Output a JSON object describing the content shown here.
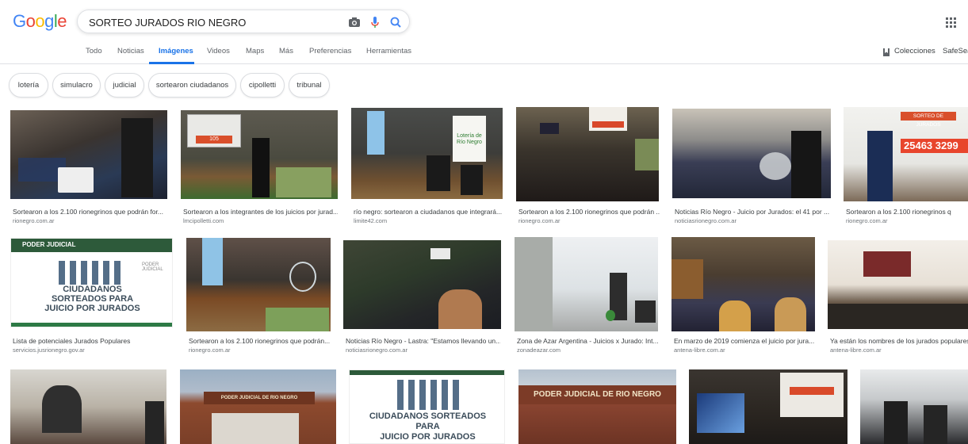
{
  "logo": {
    "letters": [
      "G",
      "o",
      "o",
      "g",
      "l",
      "e"
    ],
    "colors": [
      "#4285F4",
      "#EA4335",
      "#FBBC05",
      "#4285F4",
      "#34A853",
      "#EA4335"
    ]
  },
  "search": {
    "query": "SORTEO JURADOS RIO NEGRO",
    "camera_icon": "camera-icon",
    "mic_icon": "mic-icon",
    "search_icon": "search-icon"
  },
  "tabs": [
    {
      "label": "Todo",
      "active": false
    },
    {
      "label": "Noticias",
      "active": false
    },
    {
      "label": "Imágenes",
      "active": true
    },
    {
      "label": "Videos",
      "active": false
    },
    {
      "label": "Maps",
      "active": false
    },
    {
      "label": "Más",
      "active": false
    },
    {
      "label": "Preferencias",
      "active": false
    },
    {
      "label": "Herramientas",
      "active": false
    }
  ],
  "right_tools": {
    "collections": "Colecciones",
    "safesearch": "SafeSea"
  },
  "chips": [
    "lotería",
    "simulacro",
    "judicial",
    "sortearon ciudadanos",
    "cipolletti",
    "tribunal"
  ],
  "results": [
    {
      "title": "Sortearon a los 2.100 rionegrinos que podrán for...",
      "source": "rionegro.com.ar"
    },
    {
      "title": "Sortearon a los integrantes de los juicios por jurad...",
      "source": "lmcipolletti.com"
    },
    {
      "title": "río negro: sortearon a ciudadanos que integrará...",
      "source": "limite42.com"
    },
    {
      "title": "Sortearon a los 2.100 rionegrinos que podrán ...",
      "source": "rionegro.com.ar"
    },
    {
      "title": "Noticias Río Negro - Juicio por Jurados: el 41 por ...",
      "source": "noticiasrionegro.com.ar"
    },
    {
      "title": "Sortearon a los 2.100 rionegrinos q",
      "source": "rionegro.com.ar"
    },
    {
      "title": "Lista de potenciales Jurados Populares",
      "source": "servicios.jusrionegro.gov.ar"
    },
    {
      "title": "Sortearon a los 2.100 rionegrinos que podrán...",
      "source": "rionegro.com.ar"
    },
    {
      "title": "Noticias Río Negro - Lastra: \"Estamos llevando un...",
      "source": "noticiasrionegro.com.ar"
    },
    {
      "title": "Zona de Azar Argentina - Juicios x Jurado: Int...",
      "source": "zonadeazar.com"
    },
    {
      "title": "En marzo de 2019 comienza el juicio por jura...",
      "source": "antena-libre.com.ar"
    },
    {
      "title": "Ya están los nombres de los jurados populares",
      "source": "antena-libre.com.ar"
    },
    {
      "title": "",
      "source": ""
    },
    {
      "title": "",
      "source": ""
    },
    {
      "title": "",
      "source": ""
    },
    {
      "title": "",
      "source": ""
    },
    {
      "title": "",
      "source": ""
    },
    {
      "title": "",
      "source": ""
    }
  ],
  "image_texts": {
    "sorteo_header": "SORTEO DE JURADOS",
    "sorteo_numbers": "25463 3299",
    "screen_num_small": "105",
    "loteria_sign": "Lotería de Río Negro",
    "poder_judicial": "PODER JUDICIAL",
    "poder_judicial_sub": "PODER JUDICIAL",
    "ciudadanos_1": "CIUDADANOS",
    "ciudadanos_2": "SORTEADOS PARA",
    "ciudadanos_3": "JUICIO POR JURADOS",
    "ciudadanos_b": "CIUDADANOS SORTEADOS",
    "para_b": "PARA",
    "juicio_b": "JUICIO POR JURADOS",
    "building_sign": "PODER JUDICIAL DE RIO NEGRO",
    "building_sign_small": "PODER JUDICIAL DE RIO NEGRO"
  }
}
